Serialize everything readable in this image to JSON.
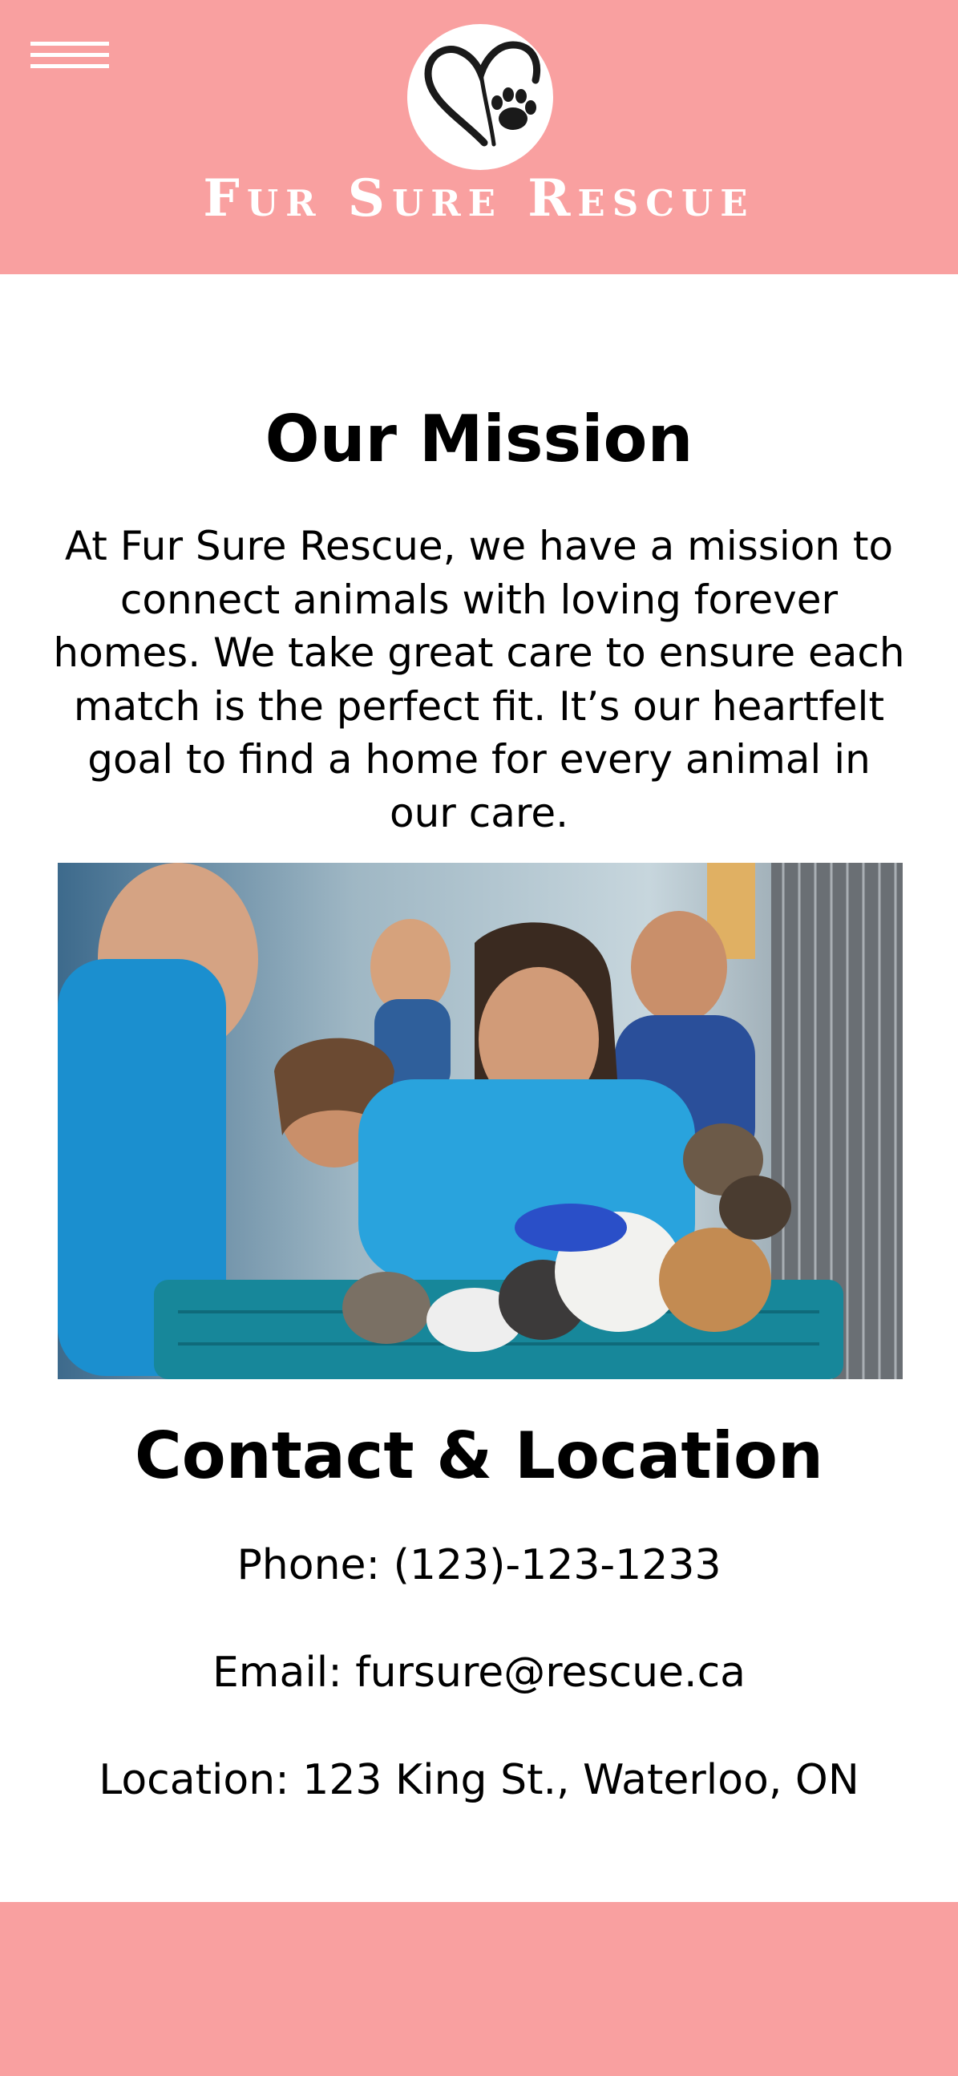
{
  "header": {
    "brand": "Fur Sure Rescue",
    "menu_icon": "hamburger-menu-icon",
    "logo_icon": "heart-paw-icon",
    "background_color": "#f9a0a0"
  },
  "mission": {
    "title": "Our Mission",
    "text": "At Fur Sure Rescue, we have a mission to connect animals with loving forever homes. We take great care to ensure each match is the perfect fit. It’s our heartfelt goal to find a home for every animal in our care."
  },
  "photo": {
    "icon": "volunteers-with-puppies-photo"
  },
  "contact": {
    "title": "Contact & Location",
    "phone": "Phone: (123)-123-1233",
    "email": "Email: fursure@rescue.ca",
    "location": "Location: 123 King St., Waterloo, ON"
  },
  "footer": {
    "background_color": "#f9a0a0"
  }
}
